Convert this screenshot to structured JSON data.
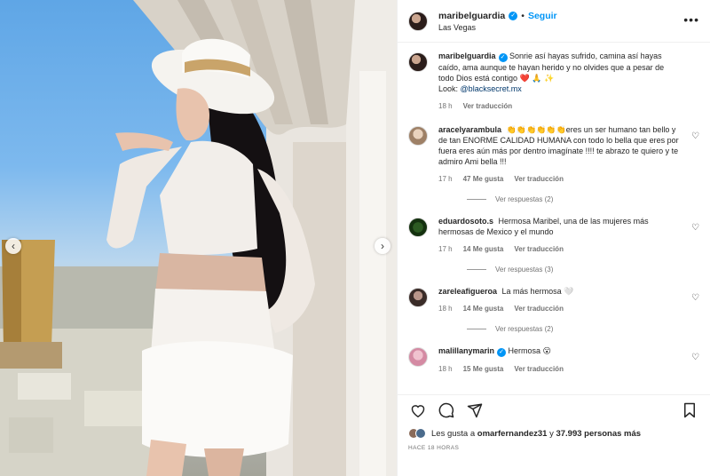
{
  "post": {
    "username": "maribelguardia",
    "follow_label": "Seguir",
    "location": "Las Vegas",
    "caption_parts": {
      "text": "Sonrie así hayas sufrido, camina así hayas caído, ama aunque te hayan herido y no olvides que a pesar de todo Dios está contigo ❤️ 🙏 ✨",
      "look_label": "Look:",
      "look_mention": "@blacksecret.mx"
    },
    "caption_time": "18 h",
    "see_translation": "Ver traducción"
  },
  "comments": [
    {
      "username": "aracelyarambula",
      "text": "👏👏👏👏👏👏eres un ser humano tan bello y de tan ENORME CALIDAD HUMANA con todo lo bella que eres por fuera eres aún más por dentro imagínate !!!! te abrazo te quiero y te admiro Ami bella !!!",
      "time": "17 h",
      "likes": "47 Me gusta",
      "translate": "Ver traducción",
      "replies": "Ver respuestas (2)"
    },
    {
      "username": "eduardosoto.s",
      "text": "Hermosa Maribel, una de las mujeres más hermosas de Mexico y el mundo",
      "time": "17 h",
      "likes": "14 Me gusta",
      "translate": "Ver traducción",
      "replies": "Ver respuestas (3)"
    },
    {
      "username": "zareleafigueroa",
      "text": "La más hermosa 🤍",
      "time": "18 h",
      "likes": "14 Me gusta",
      "translate": "Ver traducción",
      "replies": "Ver respuestas (2)"
    },
    {
      "username": "malillanymarin",
      "text": "Hermosa 😮",
      "time": "18 h",
      "likes": "15 Me gusta",
      "translate": "Ver traducción"
    }
  ],
  "likes_line": {
    "prefix": "Les gusta a",
    "user": "omarfernandez31",
    "middle": "y",
    "count": "37.993 personas más"
  },
  "time_ago": "HACE 18 HORAS",
  "icons": {
    "more": "more-options-icon",
    "like": "heart-icon",
    "comment": "comment-icon",
    "share": "share-icon",
    "save": "bookmark-icon",
    "verified": "verified-badge-icon"
  },
  "colors": {
    "accent": "#0095f6",
    "text": "#262626",
    "muted": "#737373"
  }
}
